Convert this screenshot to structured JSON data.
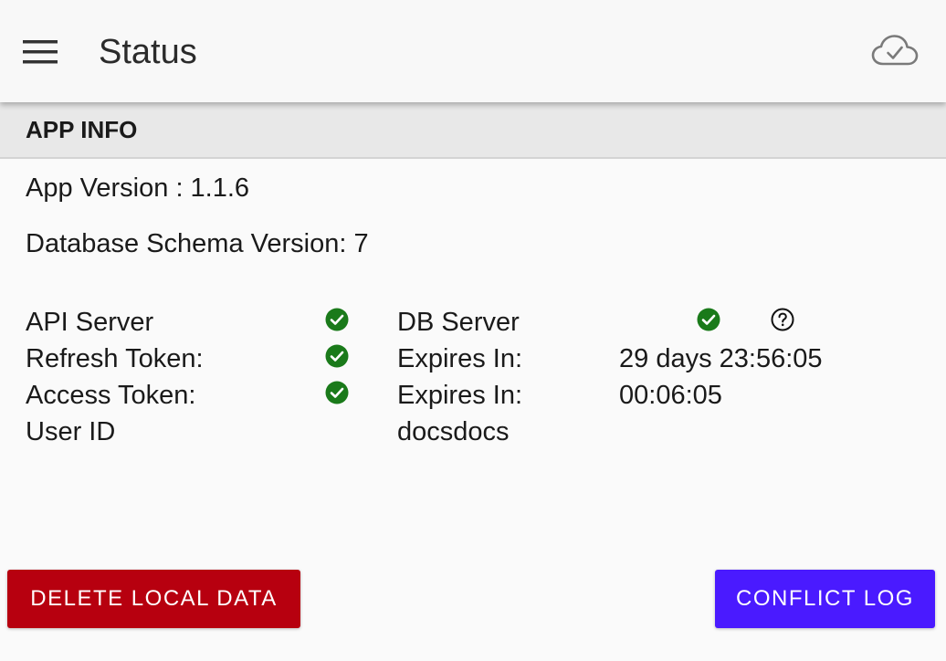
{
  "header": {
    "title": "Status",
    "menu_icon": "hamburger-menu-icon",
    "cloud_icon": "cloud-check-icon"
  },
  "section": {
    "title": "APP INFO"
  },
  "app_info": {
    "app_version": "App Version : 1.1.6",
    "schema_version": "Database Schema Version: 7"
  },
  "status": {
    "api_server_label": "API Server",
    "db_server_label": "DB Server",
    "refresh_token_label": "Refresh Token:",
    "refresh_expires_label": "Expires In:",
    "refresh_expires_value": "29 days 23:56:05",
    "access_token_label": "Access Token:",
    "access_expires_label": "Expires In:",
    "access_expires_value": "00:06:05",
    "user_id_label": "User ID",
    "user_id_value": "docsdocs",
    "ok_icon": "check-circle-icon",
    "help_icon": "help-circle-icon"
  },
  "actions": {
    "delete_label": "DELETE LOCAL DATA",
    "conflict_label": "CONFLICT LOG"
  },
  "colors": {
    "ok_green": "#1a7a1a",
    "delete_red": "#b7000f",
    "conflict_blue": "#4a1aff"
  }
}
